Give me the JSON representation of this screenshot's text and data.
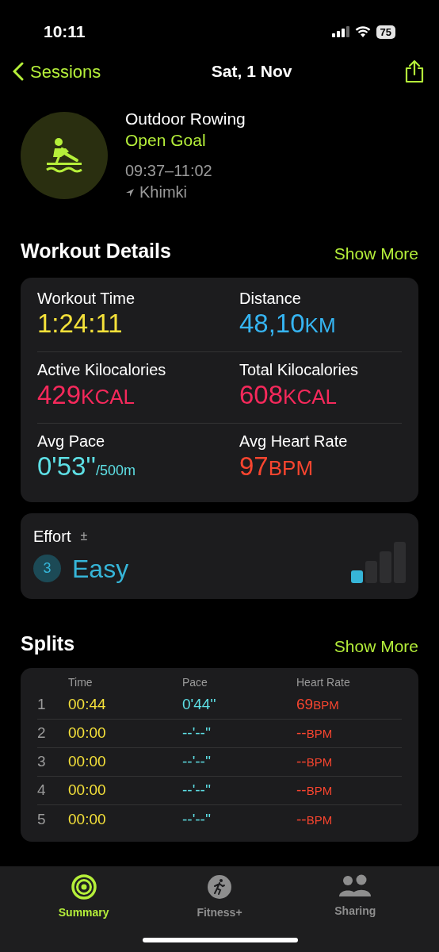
{
  "status_bar": {
    "time": "10:11",
    "battery": "75"
  },
  "nav": {
    "back": "Sessions",
    "title": "Sat, 1 Nov"
  },
  "workout": {
    "name": "Outdoor Rowing",
    "goal": "Open Goal",
    "time_range": "09:37–11:02",
    "location": "Khimki"
  },
  "details": {
    "title": "Workout Details",
    "action": "Show More",
    "metrics": [
      {
        "label": "Workout Time",
        "value": "1:24:11",
        "color": "#f5e13a"
      },
      {
        "label": "Distance",
        "value": "48,10",
        "unit": "KM",
        "color": "#36b5f2"
      },
      {
        "label": "Active Kilocalories",
        "value": "429",
        "unit": "KCAL",
        "color": "#f5295b"
      },
      {
        "label": "Total Kilocalories",
        "value": "608",
        "unit": "KCAL",
        "color": "#f5295b"
      },
      {
        "label": "Avg Pace",
        "value": "0'53''",
        "unit": "/500m",
        "color": "#5ee0e6"
      },
      {
        "label": "Avg Heart Rate",
        "value": "97",
        "unit": "BPM",
        "color": "#f8452f"
      }
    ]
  },
  "effort": {
    "label": "Effort",
    "adjust": "±",
    "score": "3",
    "rating": "Easy"
  },
  "splits": {
    "title": "Splits",
    "action": "Show More",
    "columns": [
      "Time",
      "Pace",
      "Heart Rate"
    ],
    "rows": [
      {
        "index": "1",
        "time": "00:44",
        "pace": "0'44''",
        "heart_rate": "69",
        "unit": "BPM"
      },
      {
        "index": "2",
        "time": "00:00",
        "pace": "--'--''",
        "heart_rate": "--",
        "unit": "BPM"
      },
      {
        "index": "3",
        "time": "00:00",
        "pace": "--'--''",
        "heart_rate": "--",
        "unit": "BPM"
      },
      {
        "index": "4",
        "time": "00:00",
        "pace": "--'--''",
        "heart_rate": "--",
        "unit": "BPM"
      },
      {
        "index": "5",
        "time": "00:00",
        "pace": "--'--''",
        "heart_rate": "--",
        "unit": "BPM"
      }
    ]
  },
  "tab_bar": [
    {
      "label": "Summary",
      "kind": "rings",
      "selected": true
    },
    {
      "label": "Fitness+",
      "kind": "runner",
      "selected": false
    },
    {
      "label": "Sharing",
      "kind": "people",
      "selected": false
    }
  ]
}
